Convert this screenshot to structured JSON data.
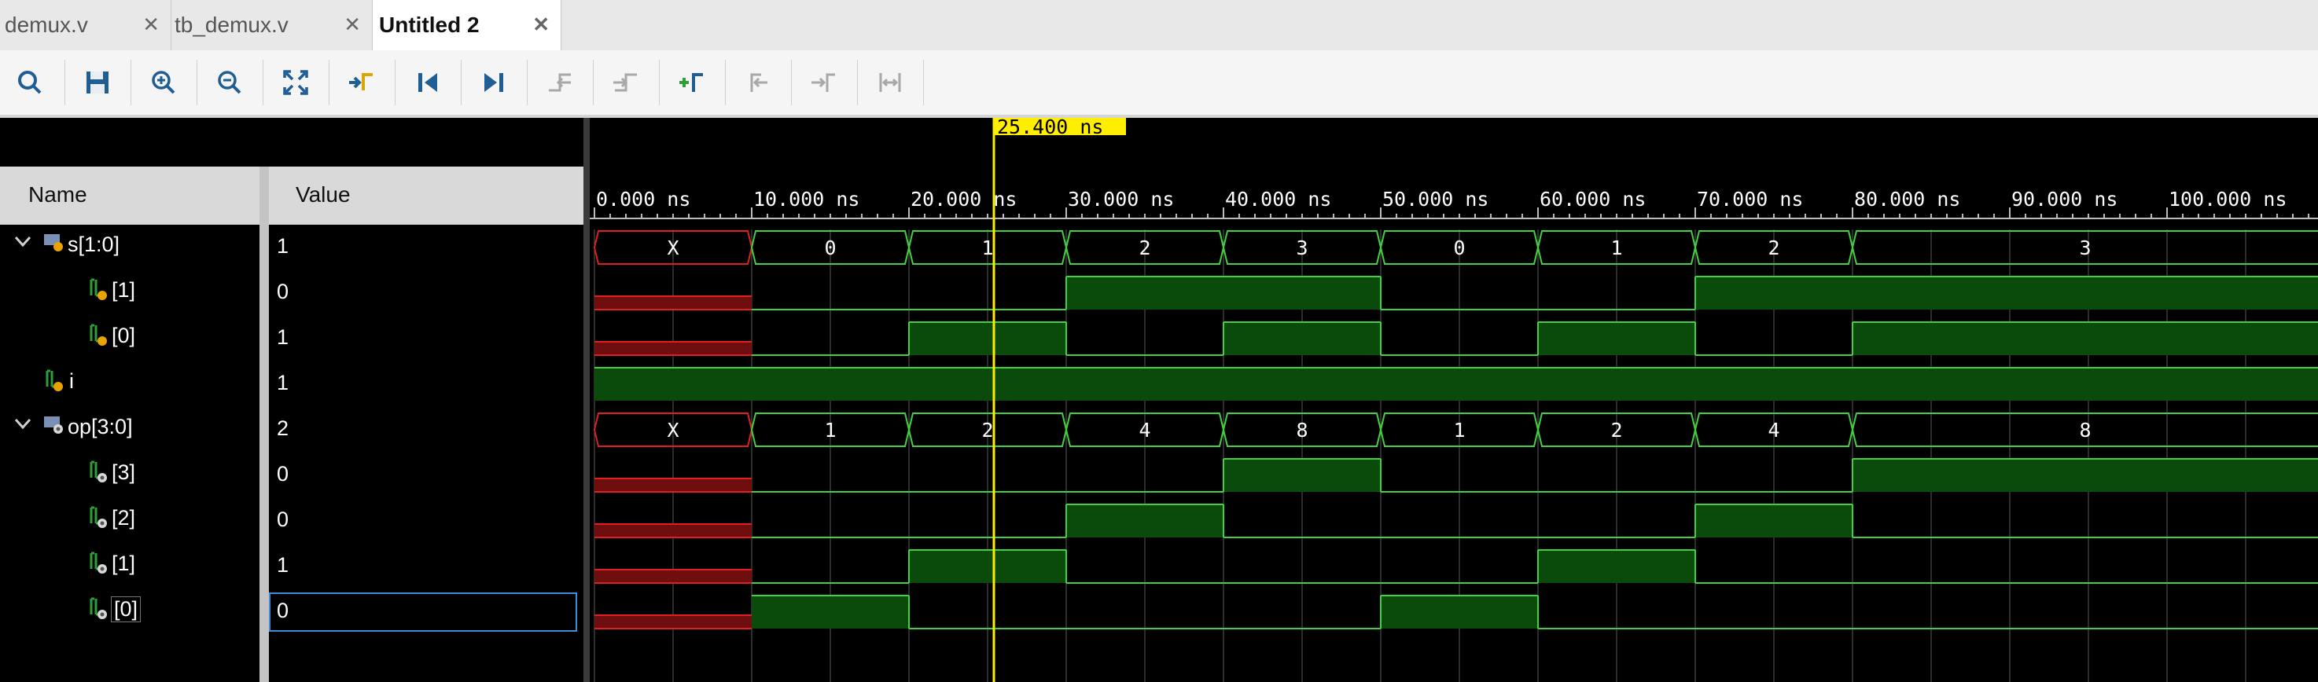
{
  "tabs": [
    {
      "label": "demux.v",
      "close": "✕"
    },
    {
      "label": "tb_demux.v",
      "close": "✕"
    },
    {
      "label": "Untitled 2",
      "close": "✕"
    }
  ],
  "toolbar": [
    {
      "name": "search-button",
      "icon": "search-icon"
    },
    {
      "name": "save-button",
      "icon": "save-icon"
    },
    {
      "name": "zoom-in-button",
      "icon": "zoom-in-icon"
    },
    {
      "name": "zoom-out-button",
      "icon": "zoom-out-icon"
    },
    {
      "name": "zoom-fit-button",
      "icon": "zoom-fit-icon"
    },
    {
      "name": "go-to-cursor-button",
      "icon": "go-to-cursor-icon"
    },
    {
      "name": "go-to-start-button",
      "icon": "go-to-start-icon"
    },
    {
      "name": "go-to-end-button",
      "icon": "go-to-end-icon"
    },
    {
      "name": "previous-transition-button",
      "icon": "previous-transition-icon"
    },
    {
      "name": "next-transition-button",
      "icon": "next-transition-icon"
    },
    {
      "name": "add-marker-button",
      "icon": "add-marker-icon"
    },
    {
      "name": "previous-marker-button",
      "icon": "previous-marker-icon"
    },
    {
      "name": "next-marker-button",
      "icon": "next-marker-icon"
    },
    {
      "name": "swap-cursors-button",
      "icon": "swap-cursors-icon"
    }
  ],
  "columns": {
    "name": "Name",
    "value": "Value"
  },
  "signals": [
    {
      "name": "s[1:0]",
      "value": "1",
      "type": "bus",
      "expanded": true,
      "depth": 0
    },
    {
      "name": "[1]",
      "value": "0",
      "type": "in",
      "depth": 1
    },
    {
      "name": "[0]",
      "value": "1",
      "type": "in",
      "depth": 1
    },
    {
      "name": "i",
      "value": "1",
      "type": "in",
      "depth": 0
    },
    {
      "name": "op[3:0]",
      "value": "2",
      "type": "bus",
      "expanded": true,
      "depth": 0
    },
    {
      "name": "[3]",
      "value": "0",
      "type": "out",
      "depth": 1
    },
    {
      "name": "[2]",
      "value": "0",
      "type": "out",
      "depth": 1
    },
    {
      "name": "[1]",
      "value": "1",
      "type": "out",
      "depth": 1
    },
    {
      "name": "[0]",
      "value": "0",
      "type": "out",
      "depth": 1,
      "selected": true
    }
  ],
  "timeline": {
    "cursor_label": "25.400 ns",
    "cursor_ns": 25.4,
    "unit": "ns",
    "tick_labels": [
      "0.000 ns",
      "10.000 ns",
      "20.000 ns",
      "30.000 ns",
      "40.000 ns",
      "50.000 ns",
      "60.000 ns",
      "70.000 ns",
      "80.000 ns",
      "90.000 ns",
      "100.000 ns"
    ]
  },
  "waveforms": [
    {
      "kind": "bus",
      "segments": [
        [
          0,
          10,
          "X"
        ],
        [
          10,
          20,
          "0"
        ],
        [
          20,
          30,
          "1"
        ],
        [
          30,
          40,
          "2"
        ],
        [
          40,
          50,
          "3"
        ],
        [
          50,
          60,
          "0"
        ],
        [
          60,
          70,
          "1"
        ],
        [
          70,
          80,
          "2"
        ],
        [
          80,
          110,
          "3"
        ]
      ]
    },
    {
      "kind": "bit",
      "segments": [
        [
          0,
          10,
          "X"
        ],
        [
          10,
          30,
          0
        ],
        [
          30,
          50,
          1
        ],
        [
          50,
          70,
          0
        ],
        [
          70,
          110,
          1
        ]
      ]
    },
    {
      "kind": "bit",
      "segments": [
        [
          0,
          10,
          "X"
        ],
        [
          10,
          20,
          0
        ],
        [
          20,
          30,
          1
        ],
        [
          30,
          40,
          0
        ],
        [
          40,
          50,
          1
        ],
        [
          50,
          60,
          0
        ],
        [
          60,
          70,
          1
        ],
        [
          70,
          80,
          0
        ],
        [
          80,
          110,
          1
        ]
      ]
    },
    {
      "kind": "bit",
      "segments": [
        [
          0,
          110,
          1
        ]
      ]
    },
    {
      "kind": "bus",
      "segments": [
        [
          0,
          10,
          "X"
        ],
        [
          10,
          20,
          "1"
        ],
        [
          20,
          30,
          "2"
        ],
        [
          30,
          40,
          "4"
        ],
        [
          40,
          50,
          "8"
        ],
        [
          50,
          60,
          "1"
        ],
        [
          60,
          70,
          "2"
        ],
        [
          70,
          80,
          "4"
        ],
        [
          80,
          110,
          "8"
        ]
      ]
    },
    {
      "kind": "bit",
      "segments": [
        [
          0,
          10,
          "X"
        ],
        [
          10,
          40,
          0
        ],
        [
          40,
          50,
          1
        ],
        [
          50,
          80,
          0
        ],
        [
          80,
          110,
          1
        ]
      ]
    },
    {
      "kind": "bit",
      "segments": [
        [
          0,
          10,
          "X"
        ],
        [
          10,
          30,
          0
        ],
        [
          30,
          40,
          1
        ],
        [
          40,
          70,
          0
        ],
        [
          70,
          80,
          1
        ],
        [
          80,
          110,
          0
        ]
      ]
    },
    {
      "kind": "bit",
      "segments": [
        [
          0,
          10,
          "X"
        ],
        [
          10,
          20,
          0
        ],
        [
          20,
          30,
          1
        ],
        [
          30,
          60,
          0
        ],
        [
          60,
          70,
          1
        ],
        [
          70,
          110,
          0
        ]
      ]
    },
    {
      "kind": "bit",
      "segments": [
        [
          0,
          10,
          "X"
        ],
        [
          10,
          20,
          1
        ],
        [
          20,
          50,
          0
        ],
        [
          50,
          60,
          1
        ],
        [
          60,
          110,
          0
        ]
      ]
    }
  ],
  "colors": {
    "high_fill": "#0a4a0a",
    "wave_green": "#3fd13f",
    "unknown_fill": "#6e0e0e",
    "unknown_line": "#e02020",
    "cursor": "#ffee00",
    "grid": "#5a5a5a"
  }
}
